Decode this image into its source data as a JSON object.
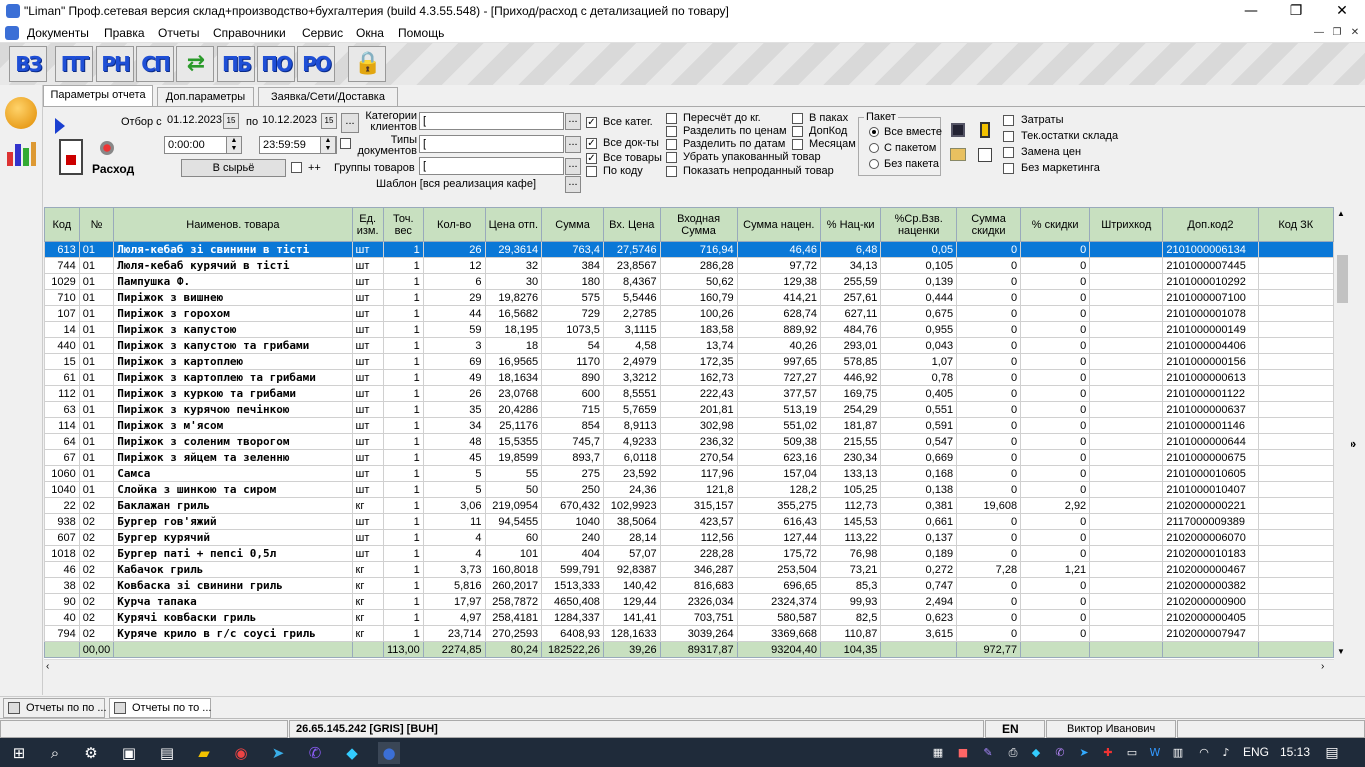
{
  "window": {
    "title": "\"Liman\" Проф.сетевая версия склад+производство+бухгалтерия (build 4.3.55.548) - [Приход/расход с детализацией по товару]",
    "minimize": "—",
    "maximize": "❐",
    "close": "✕"
  },
  "menu": [
    "Документы",
    "Правка",
    "Отчеты",
    "Справочники",
    "Сервис",
    "Окна",
    "Помощь"
  ],
  "toolbar": [
    {
      "label": "ВЗ",
      "icon": "vz-doc-icon"
    },
    {
      "label": "ПТ",
      "icon": "pt-doc-icon"
    },
    {
      "label": "РН",
      "icon": "rn-doc-icon"
    },
    {
      "label": "СП",
      "icon": "sp-doc-icon"
    },
    {
      "label": "⇄",
      "icon": "exchange-icon"
    },
    {
      "label": "ПБ",
      "icon": "pb-doc-icon"
    },
    {
      "label": "ПО",
      "icon": "po-doc-icon"
    },
    {
      "label": "РО",
      "icon": "ro-doc-icon"
    },
    {
      "label": "🔒",
      "icon": "lock-icon"
    }
  ],
  "tabs": [
    "Параметры отчета",
    "Доп.параметры",
    "Заявка/Сети/Доставка"
  ],
  "params": {
    "otbor_label": "Отбор с",
    "date_from": "01.12.2023",
    "date_to_label": "по",
    "date_to": "10.12.2023",
    "time_from": "0:00:00",
    "time_to": "23:59:59",
    "calendar_glyph": "15",
    "ellipsis": "...",
    "mode_label": "Расход",
    "raw_button": "В сырьё",
    "plusplus": "++",
    "categories_label": "Категории клиентов",
    "doc_types_label": "Типы документов",
    "groups_label": "Группы товаров",
    "template_label": "Шаблон [вся реализация кафе]",
    "field_value": "[",
    "checks_col1": [
      {
        "label": "Все катег.",
        "checked": true
      },
      {
        "label": "Все док-ты",
        "checked": true
      },
      {
        "label": "Все товары",
        "checked": true
      },
      {
        "label": "По коду",
        "checked": false
      }
    ],
    "checks_col2": [
      {
        "label": "Пересчёт до кг.",
        "checked": false
      },
      {
        "label": "Разделить по ценам",
        "checked": false
      },
      {
        "label": "Разделить по датам",
        "checked": false
      },
      {
        "label": "Убрать упакованный товар",
        "checked": false
      },
      {
        "label": "Показать непроданный товар",
        "checked": false
      }
    ],
    "checks_col3": [
      {
        "label": "В паках",
        "checked": false
      },
      {
        "label": "ДопКод",
        "checked": false
      },
      {
        "label": "Месяцам",
        "checked": false
      }
    ],
    "paket_title": "Пакет",
    "paket_options": [
      {
        "label": "Все вместе",
        "selected": true
      },
      {
        "label": "С пакетом",
        "selected": false
      },
      {
        "label": "Без пакета",
        "selected": false
      }
    ],
    "checks_col4": [
      {
        "label": "Затраты",
        "checked": false
      },
      {
        "label": "Тек.остатки склада",
        "checked": false
      },
      {
        "label": "Замена цен",
        "checked": false
      },
      {
        "label": "Без маркетинга",
        "checked": false
      }
    ],
    "expand_glyph": "»"
  },
  "grid": {
    "columns": [
      "Код",
      "№",
      "Наименов. товара",
      "Ед. изм.",
      "Точ. вес",
      "Кол-во",
      "Цена отп.",
      "Сумма",
      "Вх. Цена",
      "Входная Сумма",
      "Сумма нацен.",
      "% Нац-ки",
      "%Ср.Взв. наценки",
      "Сумма скидки",
      "% скидки",
      "Штрихкод",
      "Доп.код2",
      "Код ЗК"
    ],
    "rows": [
      [
        "613",
        "01",
        "Люля-кебаб зі свинини в тісті",
        "шт",
        "1",
        "26",
        "29,3614",
        "763,4",
        "27,5746",
        "716,94",
        "46,46",
        "6,48",
        "0,05",
        "0",
        "0",
        "",
        "2101000006134",
        ""
      ],
      [
        "744",
        "01",
        "Люля-кебаб курячий в тісті",
        "шт",
        "1",
        "12",
        "32",
        "384",
        "23,8567",
        "286,28",
        "97,72",
        "34,13",
        "0,105",
        "0",
        "0",
        "",
        "2101000007445",
        ""
      ],
      [
        "1029",
        "01",
        "Пампушка Ф.",
        "шт",
        "1",
        "6",
        "30",
        "180",
        "8,4367",
        "50,62",
        "129,38",
        "255,59",
        "0,139",
        "0",
        "0",
        "",
        "2101000010292",
        ""
      ],
      [
        "710",
        "01",
        "Пиріжок з вишнею",
        "шт",
        "1",
        "29",
        "19,8276",
        "575",
        "5,5446",
        "160,79",
        "414,21",
        "257,61",
        "0,444",
        "0",
        "0",
        "",
        "2101000007100",
        ""
      ],
      [
        "107",
        "01",
        "Пиріжок з горохом",
        "шт",
        "1",
        "44",
        "16,5682",
        "729",
        "2,2785",
        "100,26",
        "628,74",
        "627,11",
        "0,675",
        "0",
        "0",
        "",
        "2101000001078",
        ""
      ],
      [
        "14",
        "01",
        "Пиріжок з капустою",
        "шт",
        "1",
        "59",
        "18,195",
        "1073,5",
        "3,1115",
        "183,58",
        "889,92",
        "484,76",
        "0,955",
        "0",
        "0",
        "",
        "2101000000149",
        ""
      ],
      [
        "440",
        "01",
        "Пиріжок з капустою та грибами",
        "шт",
        "1",
        "3",
        "18",
        "54",
        "4,58",
        "13,74",
        "40,26",
        "293,01",
        "0,043",
        "0",
        "0",
        "",
        "2101000004406",
        ""
      ],
      [
        "15",
        "01",
        "Пиріжок з картоплею",
        "шт",
        "1",
        "69",
        "16,9565",
        "1170",
        "2,4979",
        "172,35",
        "997,65",
        "578,85",
        "1,07",
        "0",
        "0",
        "",
        "2101000000156",
        ""
      ],
      [
        "61",
        "01",
        "Пиріжок з картоплею та грибами",
        "шт",
        "1",
        "49",
        "18,1634",
        "890",
        "3,3212",
        "162,73",
        "727,27",
        "446,92",
        "0,78",
        "0",
        "0",
        "",
        "2101000000613",
        ""
      ],
      [
        "112",
        "01",
        "Пиріжок з куркою та грибами",
        "шт",
        "1",
        "26",
        "23,0768",
        "600",
        "8,5551",
        "222,43",
        "377,57",
        "169,75",
        "0,405",
        "0",
        "0",
        "",
        "2101000001122",
        ""
      ],
      [
        "63",
        "01",
        "Пиріжок з курячою печінкою",
        "шт",
        "1",
        "35",
        "20,4286",
        "715",
        "5,7659",
        "201,81",
        "513,19",
        "254,29",
        "0,551",
        "0",
        "0",
        "",
        "2101000000637",
        ""
      ],
      [
        "114",
        "01",
        "Пиріжок з м'ясом",
        "шт",
        "1",
        "34",
        "25,1176",
        "854",
        "8,9113",
        "302,98",
        "551,02",
        "181,87",
        "0,591",
        "0",
        "0",
        "",
        "2101000001146",
        ""
      ],
      [
        "64",
        "01",
        "Пиріжок з соленим творогом",
        "шт",
        "1",
        "48",
        "15,5355",
        "745,7",
        "4,9233",
        "236,32",
        "509,38",
        "215,55",
        "0,547",
        "0",
        "0",
        "",
        "2101000000644",
        ""
      ],
      [
        "67",
        "01",
        "Пиріжок з яйцем та зеленню",
        "шт",
        "1",
        "45",
        "19,8599",
        "893,7",
        "6,0118",
        "270,54",
        "623,16",
        "230,34",
        "0,669",
        "0",
        "0",
        "",
        "2101000000675",
        ""
      ],
      [
        "1060",
        "01",
        "Самса",
        "шт",
        "1",
        "5",
        "55",
        "275",
        "23,592",
        "117,96",
        "157,04",
        "133,13",
        "0,168",
        "0",
        "0",
        "",
        "2101000010605",
        ""
      ],
      [
        "1040",
        "01",
        "Слойка з шинкою та сиром",
        "шт",
        "1",
        "5",
        "50",
        "250",
        "24,36",
        "121,8",
        "128,2",
        "105,25",
        "0,138",
        "0",
        "0",
        "",
        "2101000010407",
        ""
      ],
      [
        "22",
        "02",
        "Баклажан гриль",
        "кг",
        "1",
        "3,06",
        "219,0954",
        "670,432",
        "102,9923",
        "315,157",
        "355,275",
        "112,73",
        "0,381",
        "19,608",
        "2,92",
        "",
        "2102000000221",
        ""
      ],
      [
        "938",
        "02",
        "Бургер гов'яжий",
        "шт",
        "1",
        "11",
        "94,5455",
        "1040",
        "38,5064",
        "423,57",
        "616,43",
        "145,53",
        "0,661",
        "0",
        "0",
        "",
        "2117000009389",
        ""
      ],
      [
        "607",
        "02",
        "Бургер курячий",
        "шт",
        "1",
        "4",
        "60",
        "240",
        "28,14",
        "112,56",
        "127,44",
        "113,22",
        "0,137",
        "0",
        "0",
        "",
        "2102000006070",
        ""
      ],
      [
        "1018",
        "02",
        "Бургер паті + пепсі 0,5л",
        "шт",
        "1",
        "4",
        "101",
        "404",
        "57,07",
        "228,28",
        "175,72",
        "76,98",
        "0,189",
        "0",
        "0",
        "",
        "2102000010183",
        ""
      ],
      [
        "46",
        "02",
        "Кабачок гриль",
        "кг",
        "1",
        "3,73",
        "160,8018",
        "599,791",
        "92,8387",
        "346,287",
        "253,504",
        "73,21",
        "0,272",
        "7,28",
        "1,21",
        "",
        "2102000000467",
        ""
      ],
      [
        "38",
        "02",
        "Ковбаска зі свинини гриль",
        "кг",
        "1",
        "5,816",
        "260,2017",
        "1513,333",
        "140,42",
        "816,683",
        "696,65",
        "85,3",
        "0,747",
        "0",
        "0",
        "",
        "2102000000382",
        ""
      ],
      [
        "90",
        "02",
        "Курча тапака",
        "кг",
        "1",
        "17,97",
        "258,7872",
        "4650,408",
        "129,44",
        "2326,034",
        "2324,374",
        "99,93",
        "2,494",
        "0",
        "0",
        "",
        "2102000000900",
        ""
      ],
      [
        "40",
        "02",
        "Курячі ковбаски гриль",
        "кг",
        "1",
        "4,97",
        "258,4181",
        "1284,337",
        "141,41",
        "703,751",
        "580,587",
        "82,5",
        "0,623",
        "0",
        "0",
        "",
        "2102000000405",
        ""
      ],
      [
        "794",
        "02",
        "Куряче крило в г/с соусі гриль",
        "кг",
        "1",
        "23,714",
        "270,2593",
        "6408,93",
        "128,1633",
        "3039,264",
        "3369,668",
        "110,87",
        "3,615",
        "0",
        "0",
        "",
        "2102000007947",
        ""
      ]
    ],
    "totals": [
      "",
      "00,00",
      "",
      "",
      "113,00",
      "2274,85",
      "80,24",
      "182522,26",
      "39,26",
      "89317,87",
      "93204,40",
      "104,35",
      "",
      "972,77",
      "",
      "",
      "",
      ""
    ]
  },
  "windows": [
    "Отчеты по по ...",
    "Отчеты по то ..."
  ],
  "status": {
    "server": "26.65.145.242 [GRIS] [BUH]",
    "lang": "EN",
    "user": "Виктор Иванович"
  },
  "taskbar": {
    "lang": "ENG",
    "time": "15:13"
  }
}
